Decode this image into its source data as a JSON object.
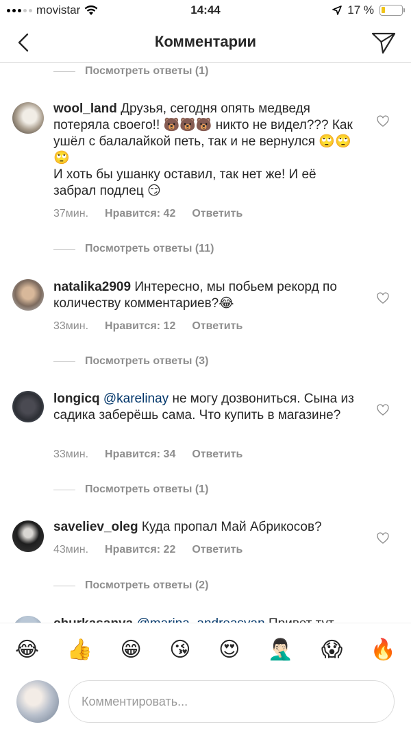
{
  "status_bar": {
    "carrier": "movistar",
    "time": "14:44",
    "battery": "17 %",
    "battery_level": 0.17
  },
  "header": {
    "title": "Комментарии",
    "back_icon": "chevron-left-icon",
    "send_icon": "paper-plane-icon"
  },
  "replies": [
    "Посмотреть ответы (1)",
    "Посмотреть ответы (11)",
    "Посмотреть ответы (3)",
    "Посмотреть ответы (1)",
    "Посмотреть ответы (2)"
  ],
  "comments": [
    {
      "username": "wool_land",
      "text": "Друзья, сегодня опять  медведя потеряла своего!! 🐻🐻🐻 никто не видел??? Как ушёл с балалайкой петь, так и не вернулся 🙄🙄🙄\nИ хоть бы ушанку оставил, так нет же! И её забрал подлец 😏",
      "time": "37мин.",
      "likes": "Нравится: 42",
      "reply": "Ответить"
    },
    {
      "username": "natalika2909",
      "text": "Интересно, мы побьем рекорд по количеству  комментариев?😂",
      "time": "33мин.",
      "likes": "Нравится: 12",
      "reply": "Ответить"
    },
    {
      "username": "longicq",
      "mention": "@karelinay",
      "text": " не могу дозвониться. Сына из садика заберёшь сама. Что купить в магазине?",
      "time": "33мин.",
      "likes": "Нравится: 34",
      "reply": "Ответить"
    },
    {
      "username": "saveliev_oleg",
      "text": "Куда пропал Май Абрикосов?",
      "time": "43мин.",
      "likes": "Нравится: 22",
      "reply": "Ответить"
    },
    {
      "username": "churkasanya",
      "mention": "@marina_andreasyan",
      "text": " Привет тут"
    }
  ],
  "emoji_bar": [
    "😂",
    "👍",
    "😁",
    "😘",
    "😍",
    "🤦🏻‍♂️",
    "😱",
    "🔥"
  ],
  "input": {
    "placeholder": "Комментировать..."
  },
  "colors": {
    "text": "#262626",
    "muted": "#8e8e8e",
    "mention": "#003569",
    "divider": "#dbdbdb"
  }
}
